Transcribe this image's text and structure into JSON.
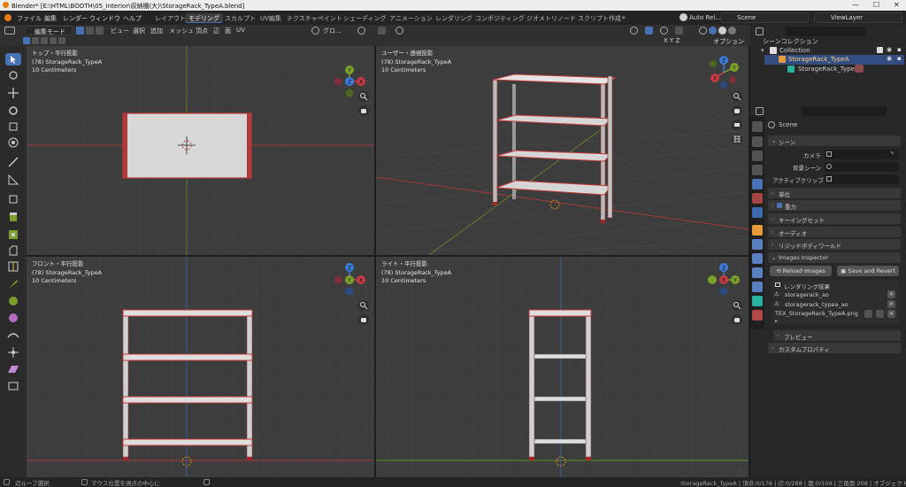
{
  "window": {
    "title": "Blender* [E:\\HTML\\BOOTH\\05_Interior\\収納棚(大)\\StorageRack_TypeA.blend]"
  },
  "menu": [
    "ファイル",
    "編集",
    "レンダー",
    "ウィンドウ",
    "ヘルプ"
  ],
  "workspaces": [
    "レイアウト",
    "モデリング",
    "スカルプト",
    "UV編集",
    "テクスチャペイント",
    "シェーディング",
    "アニメーション",
    "レンダリング",
    "コンポジティング",
    "ジオメトリノード",
    "スクリプト作成",
    "+"
  ],
  "top_right": {
    "auto": "Auto Rel...",
    "scene": "Scene",
    "view_layer": "ViewLayer"
  },
  "header3d": {
    "mode": "編集モード",
    "menus": [
      "ビュー",
      "選択",
      "追加",
      "メッシュ",
      "頂点",
      "辺",
      "面",
      "UV"
    ],
    "transform": "グロ...",
    "options": "オプション"
  },
  "viewports": {
    "top": {
      "title": "トップ・平行投影",
      "object": "(78) StorageRack_TypeA",
      "scale": "10 Centimeters"
    },
    "user": {
      "title": "ユーザー・透視投影",
      "object": "(78) StorageRack_TypeA",
      "scale": "10 Centimeters"
    },
    "front": {
      "title": "フロント・平行投影",
      "object": "(78) StorageRack_TypeA",
      "scale": "10 Centimeters"
    },
    "right": {
      "title": "ライト・平行投影",
      "object": "(78) StorageRack_TypeA",
      "scale": "10 Centimeters"
    }
  },
  "gizmo_axes": {
    "x": "X",
    "y": "Y",
    "z": "Z"
  },
  "outliner": {
    "root": "シーンコレクション",
    "collection": "Collection",
    "object": "StorageRack_TypeA",
    "mesh": "StorageRack_TypeA"
  },
  "properties": {
    "scene_name": "Scene",
    "section_scene": "シーン",
    "camera_label": "カメラ",
    "bg_scene_label": "背景シーン",
    "active_clip_label": "アクティブクリップ",
    "panels": [
      "単位",
      "重力",
      "キーイングセット",
      "オーディオ",
      "リジッドボディワールド"
    ],
    "images_inspector": "Images Inspector",
    "reload_images": "Reload Images",
    "save_revert": "Save and Revert",
    "render_result": "レンダリング結果",
    "images": [
      "storagerack_ao",
      "storagerack_typea_ao",
      "TEX_StorageRack_TypeA.png"
    ],
    "preview": "プレビュー",
    "custom_props": "カスタムプロパティ"
  },
  "status": {
    "left1": "辺ループ選択",
    "left2": "マウス位置を視点の中心に",
    "right": "StorageRack_TypeA | 頂点:0/176 | 辺:0/288 | 面:0/104 | 三角面:208 | オブジェクト:1/1 | 3.4.1"
  },
  "colors": {
    "accent": "#4772b3",
    "x_axis": "#c53a44",
    "y_axis": "#7ba02a",
    "z_axis": "#3c7cd8",
    "grid": "#474747",
    "viewport": "#3d3d3d"
  }
}
